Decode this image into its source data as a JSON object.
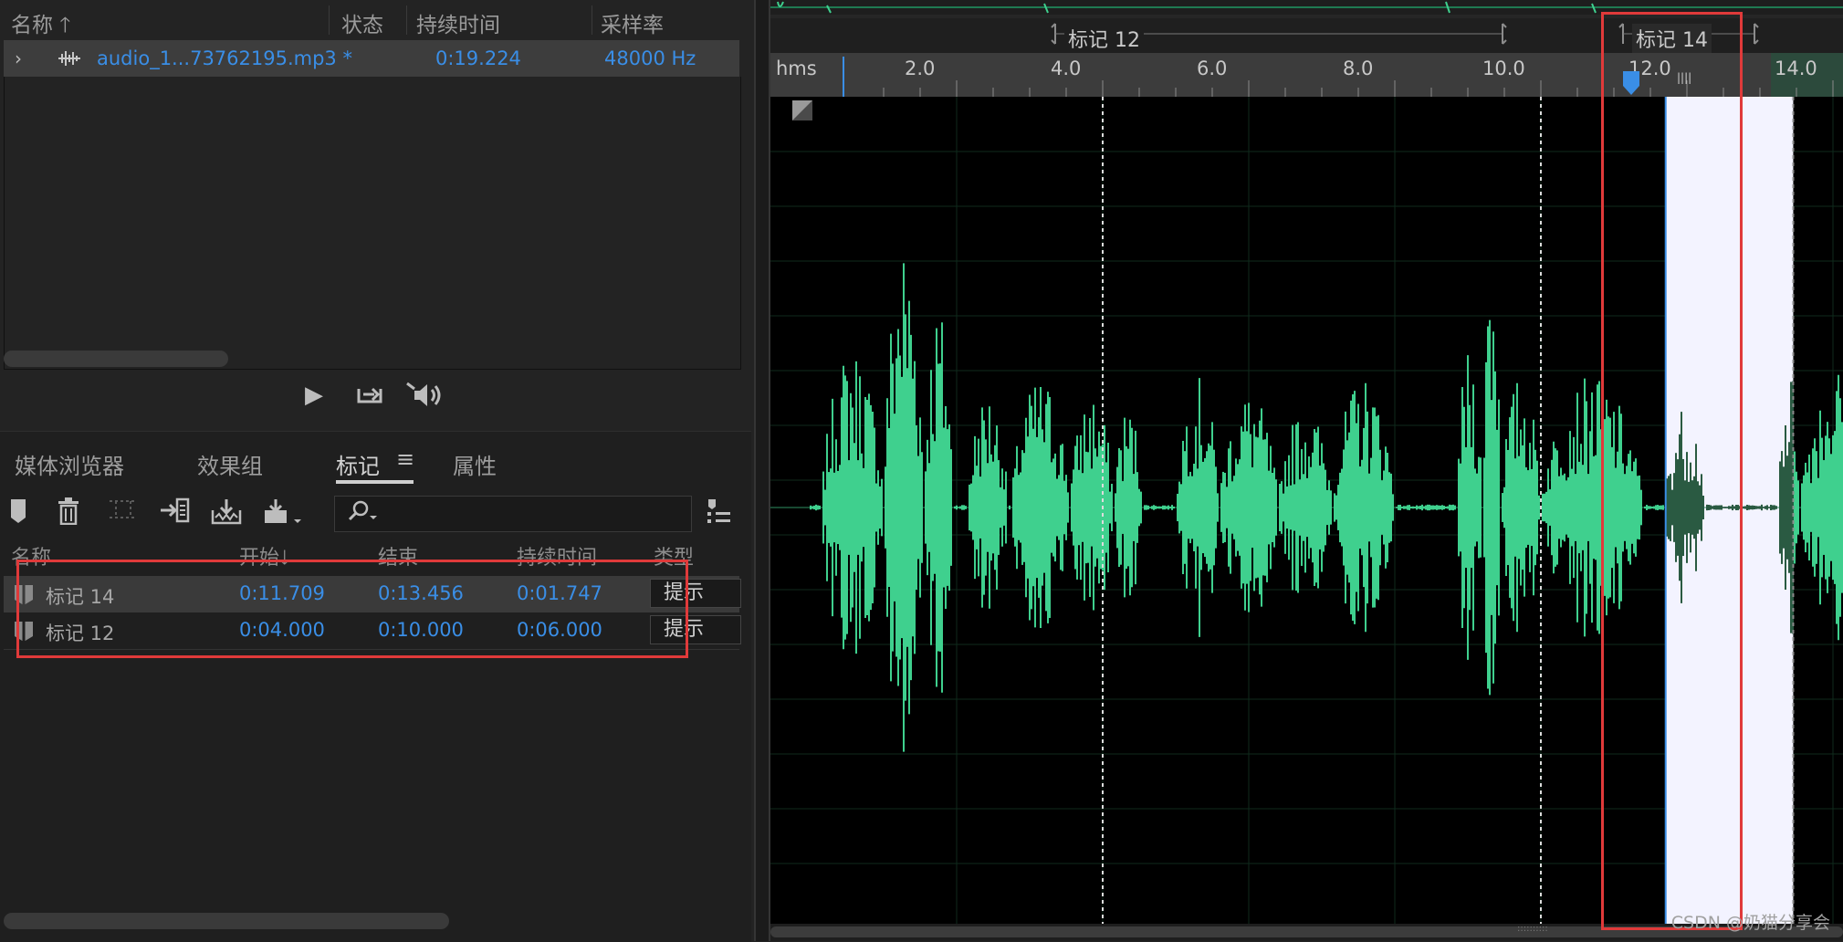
{
  "files": {
    "headers": {
      "name": "名称",
      "status": "状态",
      "duration": "持续时间",
      "samplerate": "采样率"
    },
    "file": {
      "name": "audio_1...73762195.mp3 *",
      "duration": "0:19.224",
      "samplerate": "48000 Hz"
    }
  },
  "markers": {
    "tabs": {
      "media": "媒体浏览器",
      "effects": "效果组",
      "markers": "标记",
      "properties": "属性"
    },
    "headers": {
      "name": "名称",
      "start": "开始",
      "end": "结束",
      "duration": "持续时间",
      "type": "类型"
    },
    "rows": [
      {
        "name": "标记 14",
        "start": "0:11.709",
        "end": "0:13.456",
        "duration": "0:01.747",
        "type": "提示"
      },
      {
        "name": "标记 12",
        "start": "0:04.000",
        "end": "0:10.000",
        "duration": "0:06.000",
        "type": "提示"
      }
    ]
  },
  "timeline": {
    "unit": "hms",
    "ticks": [
      "2.0",
      "4.0",
      "6.0",
      "8.0",
      "10.0",
      "12.0",
      "14.0"
    ],
    "range_markers": [
      {
        "label": "标记 12",
        "start": 4.0,
        "end": 10.0
      },
      {
        "label": "标记 14",
        "start": 11.709,
        "end": 13.456
      }
    ],
    "playhead": 11.709
  },
  "colors": {
    "waveform": "#3fd08e",
    "accent_blue": "#3a8ee6",
    "highlight_box": "#e03a3a"
  },
  "watermark": "CSDN @奶猫分享会"
}
